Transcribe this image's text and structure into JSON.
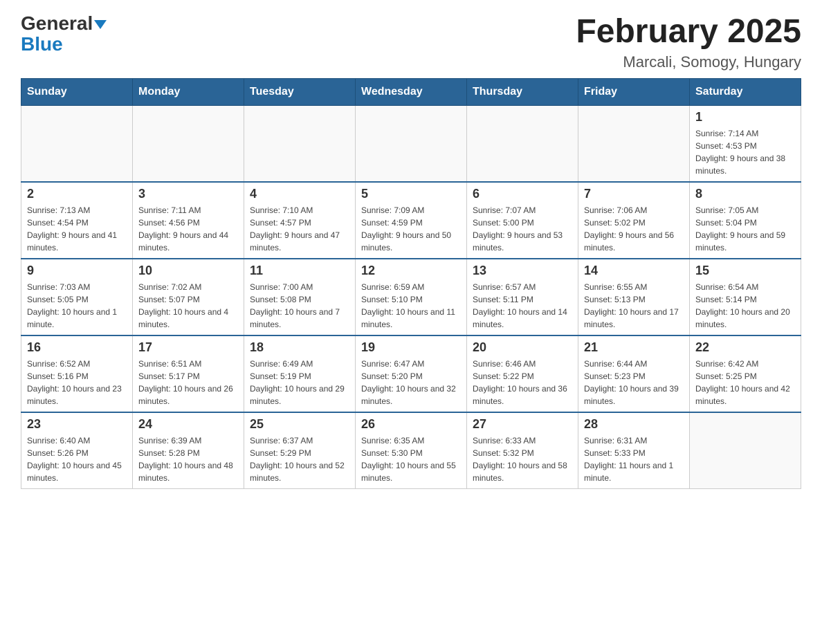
{
  "header": {
    "logo_general": "General",
    "logo_blue": "Blue",
    "month_title": "February 2025",
    "location": "Marcali, Somogy, Hungary"
  },
  "weekdays": [
    "Sunday",
    "Monday",
    "Tuesday",
    "Wednesday",
    "Thursday",
    "Friday",
    "Saturday"
  ],
  "weeks": [
    [
      {
        "day": "",
        "info": ""
      },
      {
        "day": "",
        "info": ""
      },
      {
        "day": "",
        "info": ""
      },
      {
        "day": "",
        "info": ""
      },
      {
        "day": "",
        "info": ""
      },
      {
        "day": "",
        "info": ""
      },
      {
        "day": "1",
        "info": "Sunrise: 7:14 AM\nSunset: 4:53 PM\nDaylight: 9 hours and 38 minutes."
      }
    ],
    [
      {
        "day": "2",
        "info": "Sunrise: 7:13 AM\nSunset: 4:54 PM\nDaylight: 9 hours and 41 minutes."
      },
      {
        "day": "3",
        "info": "Sunrise: 7:11 AM\nSunset: 4:56 PM\nDaylight: 9 hours and 44 minutes."
      },
      {
        "day": "4",
        "info": "Sunrise: 7:10 AM\nSunset: 4:57 PM\nDaylight: 9 hours and 47 minutes."
      },
      {
        "day": "5",
        "info": "Sunrise: 7:09 AM\nSunset: 4:59 PM\nDaylight: 9 hours and 50 minutes."
      },
      {
        "day": "6",
        "info": "Sunrise: 7:07 AM\nSunset: 5:00 PM\nDaylight: 9 hours and 53 minutes."
      },
      {
        "day": "7",
        "info": "Sunrise: 7:06 AM\nSunset: 5:02 PM\nDaylight: 9 hours and 56 minutes."
      },
      {
        "day": "8",
        "info": "Sunrise: 7:05 AM\nSunset: 5:04 PM\nDaylight: 9 hours and 59 minutes."
      }
    ],
    [
      {
        "day": "9",
        "info": "Sunrise: 7:03 AM\nSunset: 5:05 PM\nDaylight: 10 hours and 1 minute."
      },
      {
        "day": "10",
        "info": "Sunrise: 7:02 AM\nSunset: 5:07 PM\nDaylight: 10 hours and 4 minutes."
      },
      {
        "day": "11",
        "info": "Sunrise: 7:00 AM\nSunset: 5:08 PM\nDaylight: 10 hours and 7 minutes."
      },
      {
        "day": "12",
        "info": "Sunrise: 6:59 AM\nSunset: 5:10 PM\nDaylight: 10 hours and 11 minutes."
      },
      {
        "day": "13",
        "info": "Sunrise: 6:57 AM\nSunset: 5:11 PM\nDaylight: 10 hours and 14 minutes."
      },
      {
        "day": "14",
        "info": "Sunrise: 6:55 AM\nSunset: 5:13 PM\nDaylight: 10 hours and 17 minutes."
      },
      {
        "day": "15",
        "info": "Sunrise: 6:54 AM\nSunset: 5:14 PM\nDaylight: 10 hours and 20 minutes."
      }
    ],
    [
      {
        "day": "16",
        "info": "Sunrise: 6:52 AM\nSunset: 5:16 PM\nDaylight: 10 hours and 23 minutes."
      },
      {
        "day": "17",
        "info": "Sunrise: 6:51 AM\nSunset: 5:17 PM\nDaylight: 10 hours and 26 minutes."
      },
      {
        "day": "18",
        "info": "Sunrise: 6:49 AM\nSunset: 5:19 PM\nDaylight: 10 hours and 29 minutes."
      },
      {
        "day": "19",
        "info": "Sunrise: 6:47 AM\nSunset: 5:20 PM\nDaylight: 10 hours and 32 minutes."
      },
      {
        "day": "20",
        "info": "Sunrise: 6:46 AM\nSunset: 5:22 PM\nDaylight: 10 hours and 36 minutes."
      },
      {
        "day": "21",
        "info": "Sunrise: 6:44 AM\nSunset: 5:23 PM\nDaylight: 10 hours and 39 minutes."
      },
      {
        "day": "22",
        "info": "Sunrise: 6:42 AM\nSunset: 5:25 PM\nDaylight: 10 hours and 42 minutes."
      }
    ],
    [
      {
        "day": "23",
        "info": "Sunrise: 6:40 AM\nSunset: 5:26 PM\nDaylight: 10 hours and 45 minutes."
      },
      {
        "day": "24",
        "info": "Sunrise: 6:39 AM\nSunset: 5:28 PM\nDaylight: 10 hours and 48 minutes."
      },
      {
        "day": "25",
        "info": "Sunrise: 6:37 AM\nSunset: 5:29 PM\nDaylight: 10 hours and 52 minutes."
      },
      {
        "day": "26",
        "info": "Sunrise: 6:35 AM\nSunset: 5:30 PM\nDaylight: 10 hours and 55 minutes."
      },
      {
        "day": "27",
        "info": "Sunrise: 6:33 AM\nSunset: 5:32 PM\nDaylight: 10 hours and 58 minutes."
      },
      {
        "day": "28",
        "info": "Sunrise: 6:31 AM\nSunset: 5:33 PM\nDaylight: 11 hours and 1 minute."
      },
      {
        "day": "",
        "info": ""
      }
    ]
  ]
}
